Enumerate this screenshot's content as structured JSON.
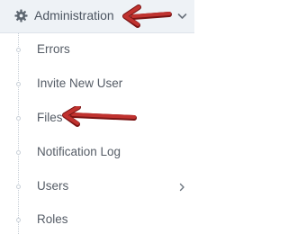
{
  "menu": {
    "header": {
      "title": "Administration",
      "icon": "gear-icon"
    },
    "items": [
      {
        "label": "Errors"
      },
      {
        "label": "Invite New User"
      },
      {
        "label": "Files"
      },
      {
        "label": "Notification Log"
      },
      {
        "label": "Users",
        "has_submenu": true
      },
      {
        "label": "Roles"
      }
    ]
  },
  "colors": {
    "header_bg": "#eef2f6",
    "text": "#555c66",
    "annotation_arrow": "#b8312f"
  }
}
